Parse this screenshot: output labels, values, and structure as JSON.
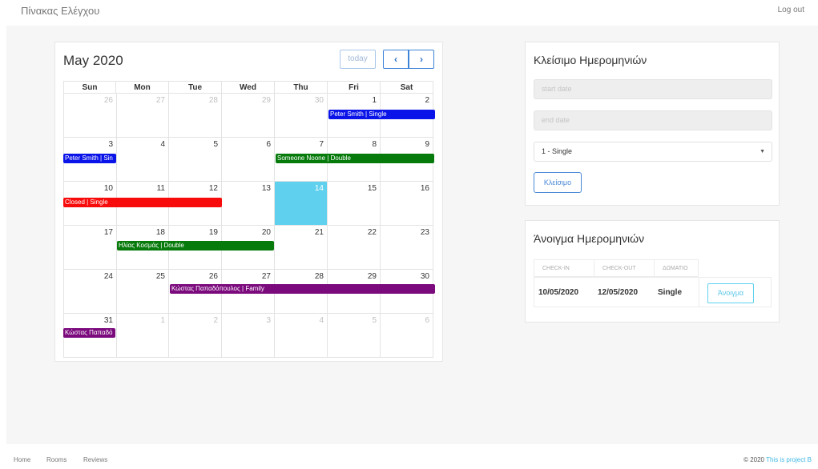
{
  "nav": {
    "brand": "Πίνακας Ελέγχου",
    "logout": "Log out"
  },
  "calendar": {
    "title": "May 2020",
    "today_label": "today",
    "prev_icon": "‹",
    "next_icon": "›",
    "days_of_week": [
      "Sun",
      "Mon",
      "Tue",
      "Wed",
      "Thu",
      "Fri",
      "Sat"
    ],
    "weeks": [
      [
        "26",
        "27",
        "28",
        "29",
        "30",
        "1",
        "2"
      ],
      [
        "3",
        "4",
        "5",
        "6",
        "7",
        "8",
        "9"
      ],
      [
        "10",
        "11",
        "12",
        "13",
        "14",
        "15",
        "16"
      ],
      [
        "17",
        "18",
        "19",
        "20",
        "21",
        "22",
        "23"
      ],
      [
        "24",
        "25",
        "26",
        "27",
        "28",
        "29",
        "30"
      ],
      [
        "31",
        "1",
        "2",
        "3",
        "4",
        "5",
        "6"
      ]
    ],
    "today_date": "14",
    "events": [
      {
        "label": "Peter Smith | Single",
        "color": "#0b14e8"
      },
      {
        "label": "Peter Smith | Sin",
        "color": "#0b14e8"
      },
      {
        "label": "Someone Noone | Double",
        "color": "#067a0b"
      },
      {
        "label": "Closed | Single",
        "color": "#f80b0b"
      },
      {
        "label": "Ηλίας Κοσμάς | Double",
        "color": "#067a0b"
      },
      {
        "label": "Κώστας Παπαδόπουλος | Family",
        "color": "#7b0a7d"
      },
      {
        "label": "Κώστας Παπαδό",
        "color": "#7b0a7d"
      }
    ]
  },
  "close_dates": {
    "title": "Κλείσιμο Ημερομηνιών",
    "start_placeholder": "start date",
    "end_placeholder": "end date",
    "room_selected": "1 - Single",
    "submit_label": "Κλείσιμο"
  },
  "open_dates": {
    "title": "Άνοιγμα Ημερομηνιών",
    "columns": [
      "CHECK-IN",
      "CHECK-OUT",
      "ΔΩΜΑΤΙΟ"
    ],
    "rows": [
      {
        "check_in": "10/05/2020",
        "check_out": "12/05/2020",
        "room": "Single",
        "action": "Άνοιγμα"
      }
    ]
  },
  "footer": {
    "links": [
      "Home",
      "Rooms",
      "Reviews"
    ],
    "copyright": "© 2020",
    "project": "This is project B"
  },
  "colors": {
    "accent": "#3d83d8",
    "today": "#5fd1ef",
    "background": "#f6f6f6"
  }
}
